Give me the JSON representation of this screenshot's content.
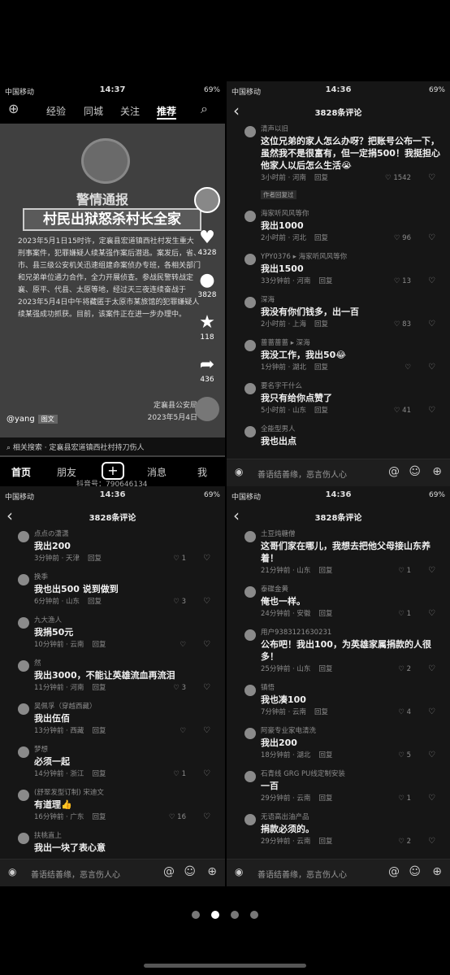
{
  "panel1": {
    "status": {
      "carrier": "中国移动",
      "time": "14:37",
      "battery": "69%"
    },
    "tabs": [
      "经验",
      "同城",
      "关注",
      "推荐"
    ],
    "video": {
      "notice_title": "警情通报",
      "banner": "村民出狱怒杀村长全家",
      "body": "2023年5月1日15时许，定襄县宏道镇西社村发生重大刑事案件，犯罪嫌疑人续某强作案后潜逃。案发后，省、市、县三级公安机关迅速组建命案侦办专班，各相关部门和兄弟单位通力合作，全力开展侦查。参战民警转战定襄、原平、代县、太原等地，经过天三夜连续奋战于2023年5月4日中午将藏匿于太原市某旅馆的犯罪嫌疑人续某强成功抓获。目前，该案件正在进一步办理中。",
      "sign_org": "定襄县公安局",
      "sign_date": "2023年5月4日",
      "likes": "4328",
      "comments": "3828",
      "favorites": "118",
      "shares": "436",
      "user": "@yang",
      "tag": "图文"
    },
    "search": "相关搜索 · 定襄县宏道镇西社村持刀伤人",
    "bottom_tabs": [
      "首页",
      "朋友",
      "消息",
      "我"
    ],
    "douyin_id": "抖音号：790646134"
  },
  "panel2": {
    "status": {
      "carrier": "中国移动",
      "time": "14:36",
      "battery": "69%"
    },
    "title": "3828条评论",
    "comments": [
      {
        "user": "清声以旧",
        "text": "这位兄弟的家人怎么办呀？把账号公布一下，虽然我不是很富有，但一定捐500！我挺担心他家人以后怎么生活😭",
        "time": "3小时前 · 河南",
        "likes": "1542",
        "badge": "作者回复过"
      },
      {
        "user": "海家听风风等你",
        "text": "我出1000",
        "time": "2小时前 · 河北",
        "likes": "96"
      },
      {
        "user": "YPY0376 ▸ 海家听风风等你",
        "text": "我出1500",
        "time": "33分钟前 · 河南",
        "likes": "13"
      },
      {
        "user": "深海",
        "text": "我没有你们钱多，出一百",
        "time": "2小时前 · 上海",
        "likes": "83"
      },
      {
        "user": "蔷蔷蔷蔷 ▸ 深海",
        "text": "我没工作，我出50😂",
        "time": "1分钟前 · 湖北",
        "likes": ""
      },
      {
        "user": "要名字干什么",
        "text": "我只有给你点赞了",
        "time": "5小时前 · 山东",
        "likes": "41"
      },
      {
        "user": "全能型男人",
        "text": "我也出点",
        "time": "",
        "likes": ""
      }
    ],
    "input_placeholder": "善语结善缘，恶言伤人心"
  },
  "panel3": {
    "status": {
      "carrier": "中国移动",
      "time": "14:36",
      "battery": "69%"
    },
    "title": "3828条评论",
    "comments": [
      {
        "user": "点点の潇潇",
        "text": "我出200",
        "time": "3分钟前 · 天津",
        "likes": "1"
      },
      {
        "user": "换季",
        "text": "我也出500  说到做到",
        "time": "6分钟前 · 山东",
        "likes": "3"
      },
      {
        "user": "九大渔人",
        "text": "我捐50元",
        "time": "10分钟前 · 云南",
        "likes": ""
      },
      {
        "user": "然",
        "text": "我出3000，不能让英雄流血再流泪",
        "time": "11分钟前 · 河南",
        "likes": "3"
      },
      {
        "user": "吴佩孚（穿越西藏）",
        "text": "我出伍佰",
        "time": "13分钟前 · 西藏",
        "likes": ""
      },
      {
        "user": "梦想",
        "text": "必须一起",
        "time": "14分钟前 · 浙江",
        "likes": "1"
      },
      {
        "user": "(舒翠发型订制) 宋迪文",
        "text": "有道理👍",
        "time": "16分钟前 · 广东",
        "likes": "16"
      },
      {
        "user": "扶桃直上",
        "text": "我出一块了表心意",
        "time": "",
        "likes": ""
      }
    ],
    "input_placeholder": "善语结善缘，恶言伤人心"
  },
  "panel4": {
    "status": {
      "carrier": "中国移动",
      "time": "14:36",
      "battery": "69%"
    },
    "title": "3828条评论",
    "comments": [
      {
        "user": "土豆炖糖僧",
        "text": "这哥们家在哪儿，我想去把他父母接山东养着！",
        "time": "21分钟前 · 山东",
        "likes": "1"
      },
      {
        "user": "泰碟金黄",
        "text": "俺也一样。",
        "time": "24分钟前 · 安徽",
        "likes": "1"
      },
      {
        "user": "用户9383121630231",
        "text": "公布吧！我出100，为英雄家属捐款的人很多！",
        "time": "25分钟前 · 山东",
        "likes": "2"
      },
      {
        "user": "镇悟",
        "text": "我也凑100",
        "time": "7分钟前 · 云南",
        "likes": "4"
      },
      {
        "user": "阿豪专业家电清洗",
        "text": "我出200",
        "time": "18分钟前 · 湖北",
        "likes": "5"
      },
      {
        "user": "石青线 GRG  PU线定制安装",
        "text": "一百",
        "time": "29分钟前 · 云南",
        "likes": "1"
      },
      {
        "user": "无语高出油产品",
        "text": "捐款必须的。",
        "time": "29分钟前 · 云南",
        "likes": "2"
      }
    ],
    "input_placeholder": "善语结善缘，恶言伤人心"
  },
  "labels": {
    "reply": "回复"
  },
  "pagination": {
    "count": 4,
    "active": 1
  }
}
